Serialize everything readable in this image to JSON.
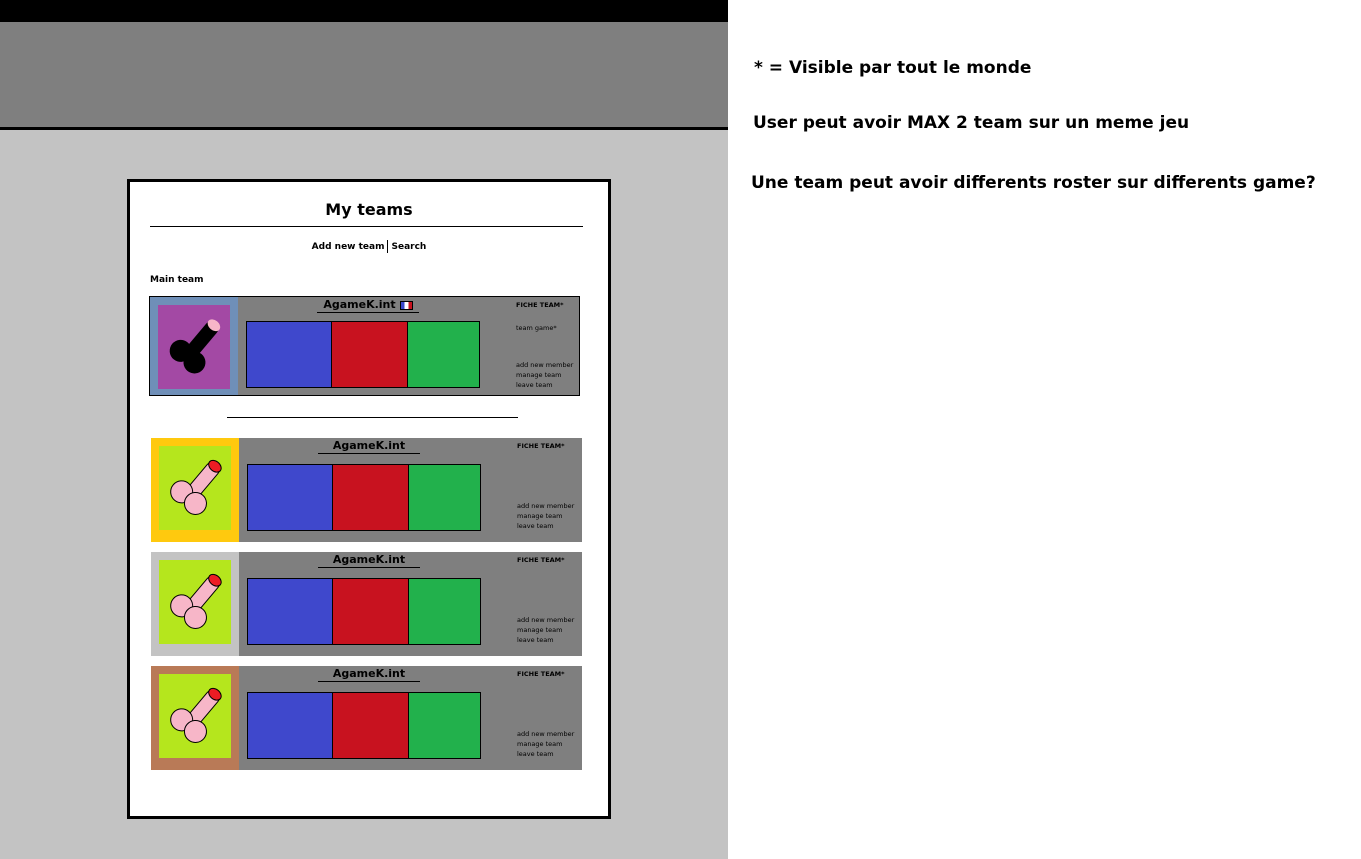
{
  "notes": {
    "visibility": "* = Visible par tout le monde",
    "max_teams": "User peut avoir MAX 2 team sur un meme jeu",
    "roster_question": "Une team peut avoir differents roster sur differents game?"
  },
  "panel": {
    "title": "My teams",
    "add_new_team": "Add new team",
    "search": "Search",
    "main_team_label": "Main team"
  },
  "colors": {
    "roster": [
      "#3f48cc",
      "#c8121f",
      "#22b14c"
    ],
    "main_frame": "#6f8fb8",
    "main_logo_bg": "#a349a4",
    "team_logo_bg": "#b5e61d",
    "frames": [
      "#ffc90e",
      "#c3c3c3",
      "#b97a57"
    ]
  },
  "main_team": {
    "name": "AgameK.int",
    "flag_icon": "flag-fr-icon",
    "fiche_team": "FICHE TEAM*",
    "team_game": "team game*",
    "add_member": "add new member",
    "manage": "manage team",
    "leave": "leave team"
  },
  "teams": [
    {
      "name": "AgameK.int",
      "fiche_team": "FICHE TEAM*",
      "add_member": "add new member",
      "manage": "manage team",
      "leave": "leave team"
    },
    {
      "name": "AgameK.int",
      "fiche_team": "FICHE TEAM*",
      "add_member": "add new member",
      "manage": "manage team",
      "leave": "leave team"
    },
    {
      "name": "AgameK.int",
      "fiche_team": "FICHE TEAM*",
      "add_member": "add new member",
      "manage": "manage team",
      "leave": "leave team"
    }
  ]
}
